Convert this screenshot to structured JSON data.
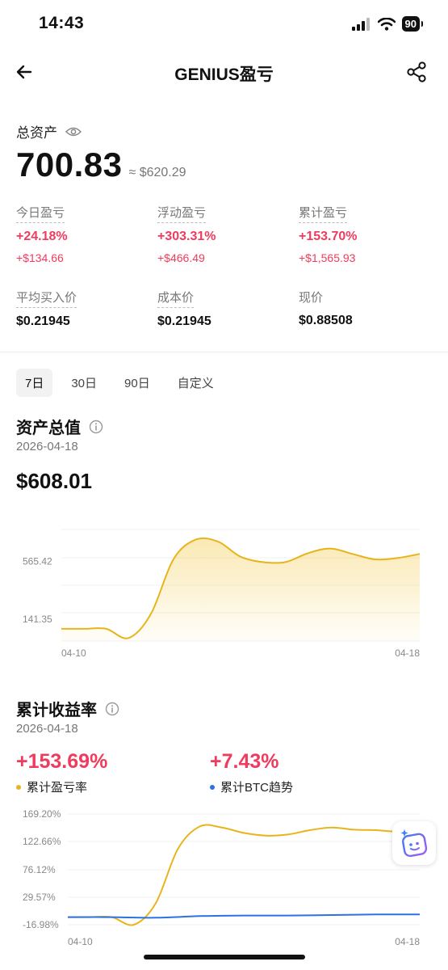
{
  "status_bar": {
    "time": "14:43",
    "battery": "90"
  },
  "nav": {
    "title": "GENIUS盈亏"
  },
  "asset": {
    "label": "总资产",
    "value": "700.83",
    "approx": "≈ $620.29"
  },
  "stats": [
    {
      "label": "今日盈亏",
      "pct": "+24.18%",
      "amount": "+$134.66"
    },
    {
      "label": "浮动盈亏",
      "pct": "+303.31%",
      "amount": "+$466.49"
    },
    {
      "label": "累计盈亏",
      "pct": "+153.70%",
      "amount": "+$1,565.93"
    }
  ],
  "prices": [
    {
      "label": "平均买入价",
      "value": "$0.21945"
    },
    {
      "label": "成本价",
      "value": "$0.21945"
    },
    {
      "label": "现价",
      "value": "$0.88508"
    }
  ],
  "range_tabs": [
    "7日",
    "30日",
    "90日",
    "自定义"
  ],
  "active_range": "7日",
  "asset_total": {
    "title": "资产总值",
    "date": "2026-04-18",
    "value": "$608.01"
  },
  "returns": {
    "title": "累计收益率",
    "date": "2026-04-18",
    "main": {
      "value": "+153.69%",
      "legend": "累计盈亏率"
    },
    "btc": {
      "value": "+7.43%",
      "legend": "累计BTC趋势"
    }
  },
  "colors": {
    "accent_red": "#ef3b5d",
    "series_gold": "#e7b51b",
    "series_blue": "#2c72e0"
  },
  "chart_data": [
    {
      "type": "area",
      "title": "资产总值",
      "x_ticks": [
        "04-10",
        "04-18"
      ],
      "y_ticks": [
        565.42,
        141.35
      ],
      "ylim": [
        -20,
        800
      ],
      "x": [
        0,
        0.5,
        1,
        1.5,
        2,
        2.5,
        3,
        3.5,
        4,
        4.5,
        5,
        5.5,
        6,
        6.5,
        7,
        7.5,
        8
      ],
      "values": [
        70,
        70,
        70,
        2,
        180,
        580,
        725,
        710,
        600,
        560,
        560,
        625,
        660,
        620,
        580,
        590,
        620
      ],
      "grid": true
    },
    {
      "type": "line",
      "title": "累计收益率",
      "x_ticks": [
        "04-10",
        "04-18"
      ],
      "y_ticks": [
        "169.20%",
        "122.66%",
        "76.12%",
        "29.57%",
        "-16.98%"
      ],
      "ylim": [
        -30,
        175
      ],
      "series": [
        {
          "name": "累计盈亏率",
          "x": [
            0,
            0.5,
            1,
            1.5,
            2,
            2.5,
            3,
            3.5,
            4,
            4.5,
            5,
            5.5,
            6,
            6.5,
            7,
            7.5,
            8
          ],
          "values": [
            -16,
            -16,
            -16,
            -30,
            10,
            110,
            152,
            150,
            140,
            135,
            137,
            145,
            150,
            146,
            145,
            143,
            150
          ]
        },
        {
          "name": "累计BTC趋势",
          "x": [
            0,
            1,
            2,
            3,
            4,
            5,
            6,
            7,
            8
          ],
          "values": [
            -16,
            -16,
            -17,
            -14,
            -13,
            -13,
            -12,
            -11,
            -11
          ]
        }
      ],
      "grid": true
    }
  ]
}
